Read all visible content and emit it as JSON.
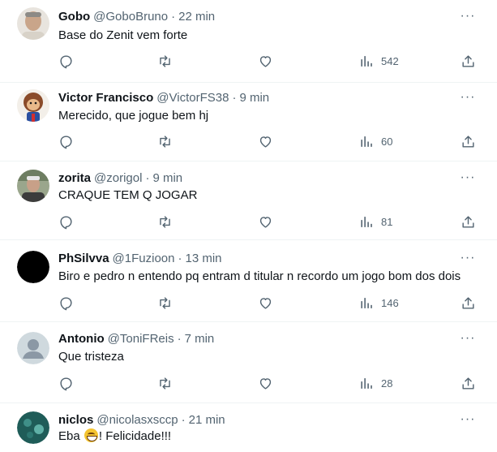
{
  "tweets": [
    {
      "name": "Gobo",
      "handle": "@GoboBruno",
      "time": "22 min",
      "text": "Base do Zenit vem forte",
      "views": "542",
      "avatar_color": "#c9b8a6",
      "avatar_style": "person"
    },
    {
      "name": "Victor Francisco",
      "handle": "@VictorFS38",
      "time": "9 min",
      "text": "Merecido, que jogue bem hj",
      "views": "60",
      "avatar_color": "#8a4b2a",
      "avatar_style": "cartoon"
    },
    {
      "name": "zorita",
      "handle": "@zorigol",
      "time": "9 min",
      "text": "CRAQUE TEM Q JOGAR",
      "views": "81",
      "avatar_color": "#7a8a6e",
      "avatar_style": "person"
    },
    {
      "name": "PhSilvva",
      "handle": "@1Fuzioon",
      "time": "13 min",
      "text": "Biro e pedro n entendo pq entram d titular n recordo um jogo bom dos dois",
      "views": "146",
      "avatar_color": "#000000",
      "avatar_style": "solid"
    },
    {
      "name": "Antonio",
      "handle": "@ToniFReis",
      "time": "7 min",
      "text": "Que tristeza",
      "views": "28",
      "avatar_color": "#cfd9de",
      "avatar_style": "default"
    },
    {
      "name": "niclos",
      "handle": "@nicolasxsccp",
      "time": "21 min",
      "text_before": "Eba ",
      "text_after": "! Felicidade!!!",
      "avatar_color": "#2f6f6a",
      "avatar_style": "teal"
    }
  ],
  "more_label": "···",
  "dot": "·",
  "colors": {
    "secondary_text": "#536471",
    "divider": "#eff3f4",
    "primary_text": "#0f1419"
  }
}
